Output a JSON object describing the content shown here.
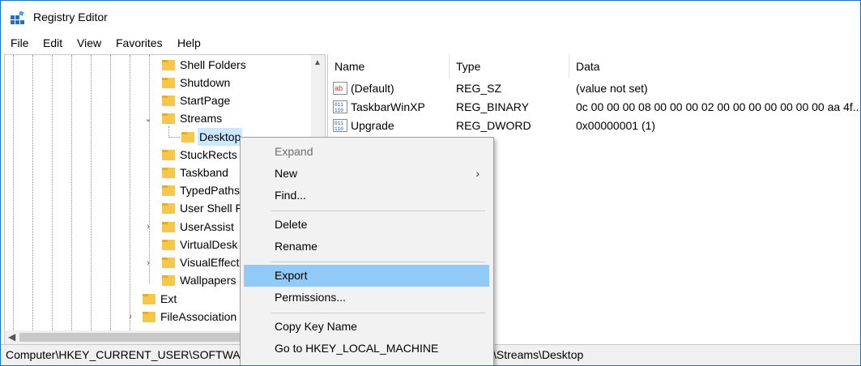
{
  "app": {
    "title": "Registry Editor"
  },
  "menubar": [
    "File",
    "Edit",
    "View",
    "Favorites",
    "Help"
  ],
  "tree": {
    "nodes": [
      {
        "label": "Shell Folders"
      },
      {
        "label": "Shutdown"
      },
      {
        "label": "StartPage"
      },
      {
        "label": "Streams"
      },
      {
        "label": "Desktop"
      },
      {
        "label": "StuckRects"
      },
      {
        "label": "Taskband"
      },
      {
        "label": "TypedPaths"
      },
      {
        "label": "User Shell F"
      },
      {
        "label": "UserAssist"
      },
      {
        "label": "VirtualDesk"
      },
      {
        "label": "VisualEffect"
      },
      {
        "label": "Wallpapers"
      },
      {
        "label": "Ext"
      },
      {
        "label": "FileAssociation"
      }
    ]
  },
  "list": {
    "columns": [
      "Name",
      "Type",
      "Data"
    ],
    "rows": [
      {
        "name": "(Default)",
        "type": "REG_SZ",
        "data": "(value not set)",
        "icon": "string-value-icon"
      },
      {
        "name": "TaskbarWinXP",
        "type": "REG_BINARY",
        "data": "0c 00 00 00 08 00 00 00 02 00 00 00 00 00 00 00 aa 4f...",
        "icon": "binary-value-icon"
      },
      {
        "name": "Upgrade",
        "type": "REG_DWORD",
        "data": "0x00000001 (1)",
        "icon": "binary-value-icon"
      }
    ]
  },
  "context_menu": {
    "items": [
      {
        "label": "Expand",
        "state": "disabled"
      },
      {
        "label": "New",
        "has_submenu": true
      },
      {
        "label": "Find..."
      },
      {
        "label": "Delete"
      },
      {
        "label": "Rename"
      },
      {
        "label": "Export",
        "state": "hover"
      },
      {
        "label": "Permissions..."
      },
      {
        "label": "Copy Key Name"
      },
      {
        "label": "Go to HKEY_LOCAL_MACHINE"
      }
    ]
  },
  "statusbar": {
    "path_left": "Computer\\HKEY_CURRENT_USER\\SOFTWAR",
    "path_right": "\\Streams\\Desktop"
  },
  "colors": {
    "window_border": "#1a73c8",
    "folder": "#f5c74a",
    "selection": "#cce8ff",
    "menu_hover": "#91c9f7"
  }
}
